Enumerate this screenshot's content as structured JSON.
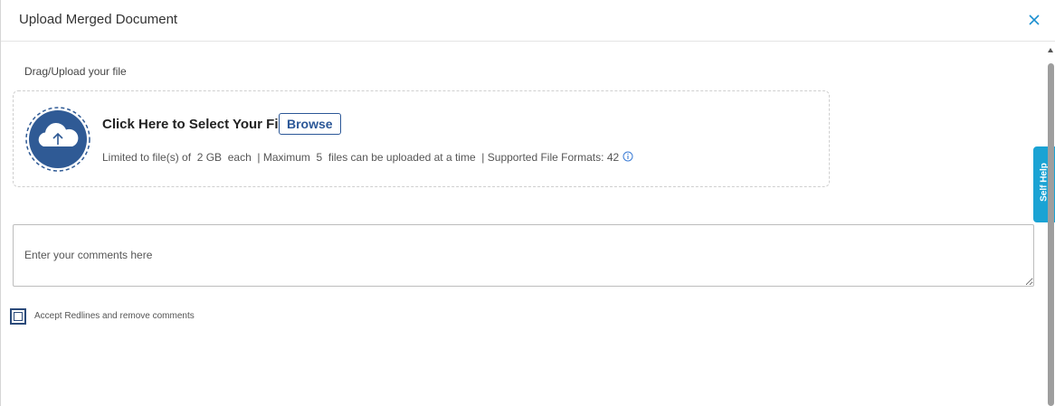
{
  "dialog": {
    "title": "Upload Merged Document",
    "close_icon": "close-icon"
  },
  "upload": {
    "section_label": "Drag/Upload your file",
    "icon": "cloud-upload-icon",
    "click_text": "Click Here to Select Your File",
    "browse_label": "Browse",
    "limits_text": "Limited to file(s) of  2 GB  each  | Maximum  5  files can be uploaded at a time  | Supported File Formats: 42",
    "info_icon": "info-icon"
  },
  "comments": {
    "placeholder": "Enter your comments here",
    "value": ""
  },
  "accept": {
    "label": "Accept Redlines and remove comments",
    "checked": false
  },
  "self_help": {
    "label": "Self Help"
  },
  "colors": {
    "accent": "#2b5797",
    "cloud": "#2f5a95",
    "self_help_bg": "#1aa3d4"
  }
}
